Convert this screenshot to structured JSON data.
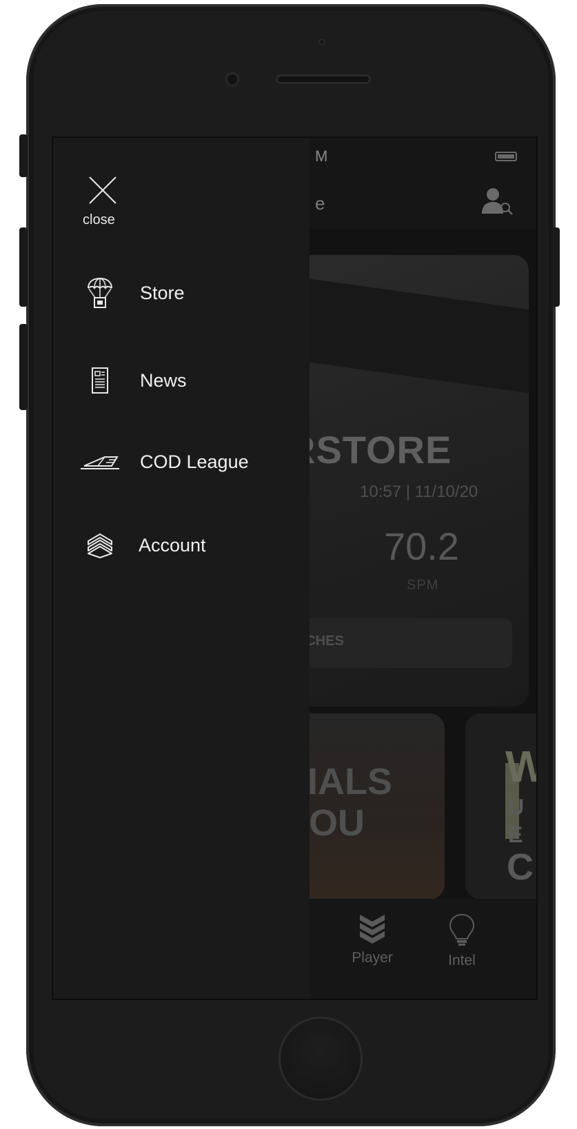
{
  "status_bar": {
    "time": "M"
  },
  "header": {
    "title": "e"
  },
  "drawer": {
    "close_label": "close",
    "items": [
      {
        "label": "Store",
        "icon": "airdrop-parachute-icon"
      },
      {
        "label": "News",
        "icon": "newspaper-icon"
      },
      {
        "label": "COD League",
        "icon": "ramp-icon"
      },
      {
        "label": "Account",
        "icon": "rank-chevrons-icon"
      }
    ]
  },
  "background": {
    "hero": {
      "title": "RSTORE",
      "timestamp": "10:57 | 11/10/20",
      "value": "70.2",
      "unit": "SPM",
      "button_label": "TCHES"
    },
    "promo": {
      "line1": "RIALS",
      "line2": "YOU"
    },
    "promo2_letters": [
      "W",
      "U",
      "E",
      "C"
    ],
    "tabs": [
      {
        "label": "Player",
        "icon": "chevrons-icon"
      },
      {
        "label": "Intel",
        "icon": "lightbulb-icon"
      }
    ]
  }
}
